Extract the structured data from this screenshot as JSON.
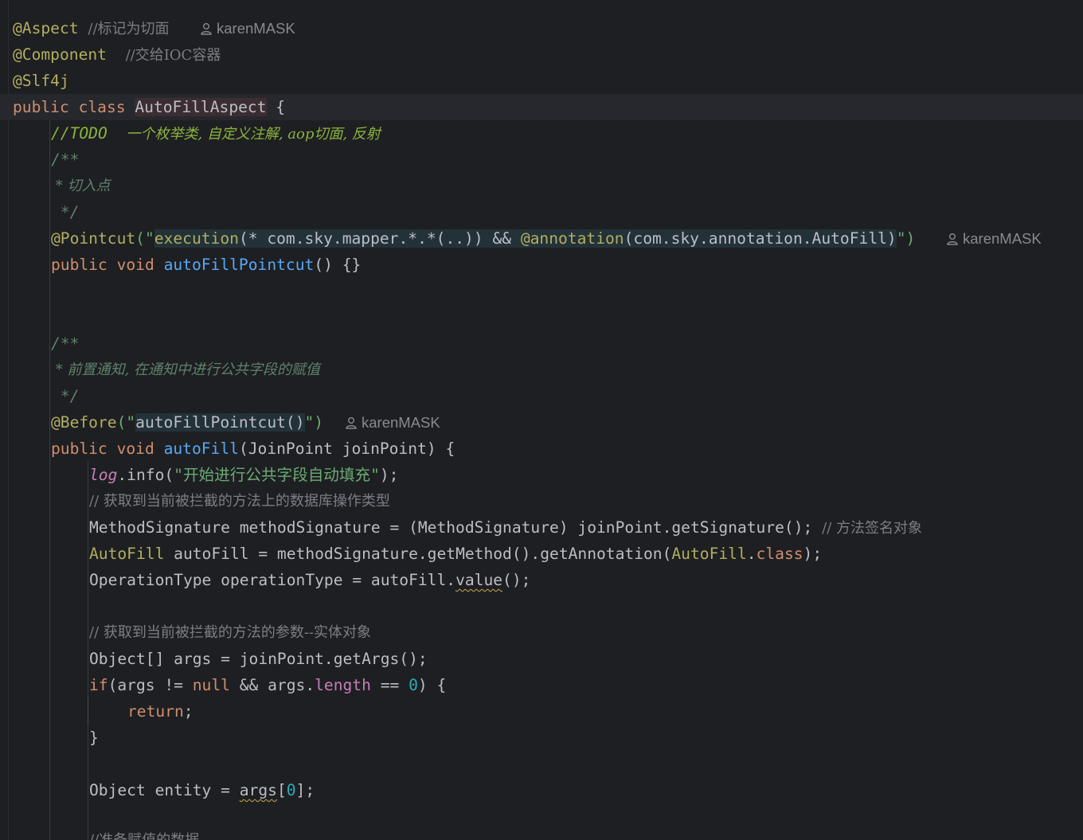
{
  "authors": {
    "name": "karenMASK"
  },
  "editor": {
    "lines": {
      "l1": {
        "code": "@Aspect",
        "comment": "//标记为切面"
      },
      "l2": {
        "code": "@Component",
        "comment": "//交给IOC容器"
      },
      "l3": {
        "code": "@Slf4j"
      },
      "l4": {
        "kw": "public class ",
        "class_name": "AutoFillAspect",
        "rest": " {"
      },
      "l5": {
        "prefix": "//",
        "todo": "TODO",
        "text": "一个枚举类, 自定义注解, aop切面, 反射"
      },
      "l6": {
        "text": "/**"
      },
      "l7": {
        "text": " * 切入点"
      },
      "l8": {
        "text": " */"
      },
      "l9": {
        "ann": "@Pointcut",
        "open": "(\"",
        "inj1": "execution",
        "inj2": "(* com.sky.mapper.*.*(..)) && ",
        "inj3": "@annotation",
        "inj4": "(com.sky.annotation.AutoFill)",
        "close": "\")"
      },
      "l10": {
        "kw": "public void ",
        "fn": "autoFillPointcut",
        "rest": "() {}"
      },
      "l13": {
        "text": "/**"
      },
      "l14": {
        "text": " * 前置通知, 在通知中进行公共字段的赋值"
      },
      "l15": {
        "text": " */"
      },
      "l16": {
        "ann": "@Before",
        "open": "(\"",
        "inj": "autoFillPointcut()",
        "close": "\")"
      },
      "l17": {
        "kw": "public void ",
        "fn": "autoFill",
        "rest": "(JoinPoint joinPoint) {"
      },
      "l18": {
        "field": "log",
        "call": ".info(",
        "str": "\"开始进行公共字段自动填充\"",
        "end": ");"
      },
      "l19": {
        "comment": "// 获取到当前被拦截的方法上的数据库操作类型"
      },
      "l20": {
        "code": "MethodSignature methodSignature = (MethodSignature) joinPoint.getSignature(); ",
        "comment": "// 方法签名对象"
      },
      "l21": {
        "type": "AutoFill",
        "code1": " autoFill = methodSignature.getMethod().getAnnotation(",
        "type2": "AutoFill",
        "dot": ".",
        "kw": "class",
        "end": ");"
      },
      "l22": {
        "code1": "OperationType operationType = autoFill.",
        "warn": "value",
        "end": "();"
      },
      "l24": {
        "comment": "// 获取到当前被拦截的方法的参数--实体对象"
      },
      "l25": {
        "code": "Object[] args = joinPoint.getArgs();"
      },
      "l26": {
        "kw1": "if",
        "code1": "(args != ",
        "kw2": "null",
        "code2": " && args.",
        "field": "length",
        "code3": " == ",
        "num": "0",
        "end": ") {"
      },
      "l27": {
        "kw": "return",
        "end": ";"
      },
      "l28": {
        "text": "}"
      },
      "l30": {
        "code1": "Object entity = ",
        "warn": "args",
        "open": "[",
        "num": "0",
        "end": "];"
      },
      "l32": {
        "comment": "//准备赋值的数据"
      }
    }
  }
}
